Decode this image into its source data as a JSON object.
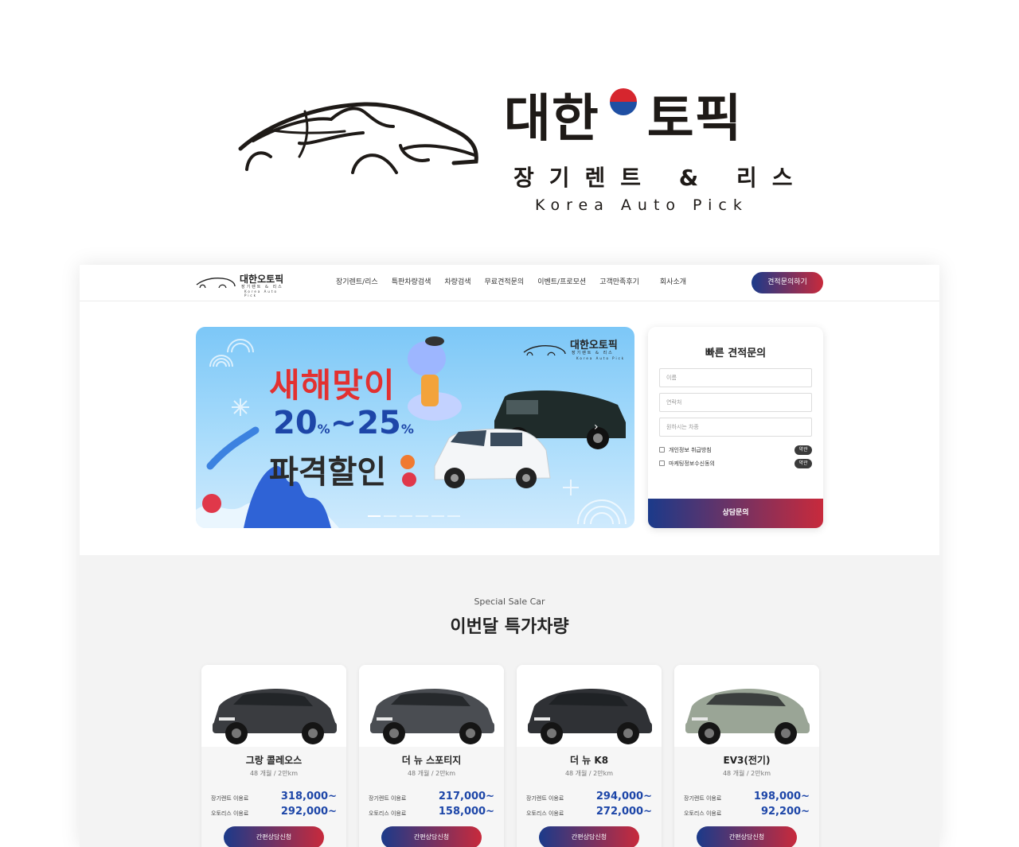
{
  "brand": {
    "title_1": "대한",
    "title_2": "토픽",
    "subtitle": "장기렌트 & 리스",
    "english": "Korea Auto Pick"
  },
  "nav": {
    "logo_title": "대한오토픽",
    "logo_sub": "장기렌트 & 리스",
    "logo_en": "Korea Auto Pick",
    "menu": [
      "장기렌트/리스",
      "특판차량검색",
      "차량검색",
      "무료견적문의",
      "이벤트/프로모션",
      "고객만족후기",
      "회사소개"
    ],
    "cta": "견적문의하기"
  },
  "banner": {
    "line1": "새해맞이",
    "line2_a": "20",
    "line2_pct1": "%",
    "line2_tilde": "~",
    "line2_b": "25",
    "line2_pct2": "%",
    "line3": "파격할인",
    "logo_title": "대한오토픽",
    "logo_sub": "장기렌트 & 리스",
    "logo_en": "Korea Auto Pick",
    "slides": 6,
    "active_slide": 1
  },
  "quote": {
    "title": "빠른 견적문의",
    "name_placeholder": "이름",
    "phone_placeholder": "연락처",
    "car_placeholder": "원하시는 차종",
    "check1": "개인정보 취급방침",
    "check2": "마케팅정보수신동의",
    "terms": "약관",
    "submit": "상담문의"
  },
  "sale": {
    "en": "Special Sale Car",
    "ko": "이번달 특가차량",
    "rent_label": "장기렌트 이용료",
    "lease_label": "오토리스 이용료",
    "button": "간편상담신청",
    "cars": [
      {
        "name": "그랑 콜레오스",
        "spec": "48 개월 / 2만km",
        "rent": "318,000~",
        "lease": "292,000~",
        "color": "#3a3c40"
      },
      {
        "name": "더 뉴 스포티지",
        "spec": "48 개월 / 2만km",
        "rent": "217,000~",
        "lease": "158,000~",
        "color": "#4a4d52"
      },
      {
        "name": "더 뉴 K8",
        "spec": "48 개월 / 2만km",
        "rent": "294,000~",
        "lease": "272,000~",
        "color": "#2f3135"
      },
      {
        "name": "EV3(전기)",
        "spec": "48 개월 / 2만km",
        "rent": "198,000~",
        "lease": "92,200~",
        "color": "#9aa596"
      }
    ]
  }
}
